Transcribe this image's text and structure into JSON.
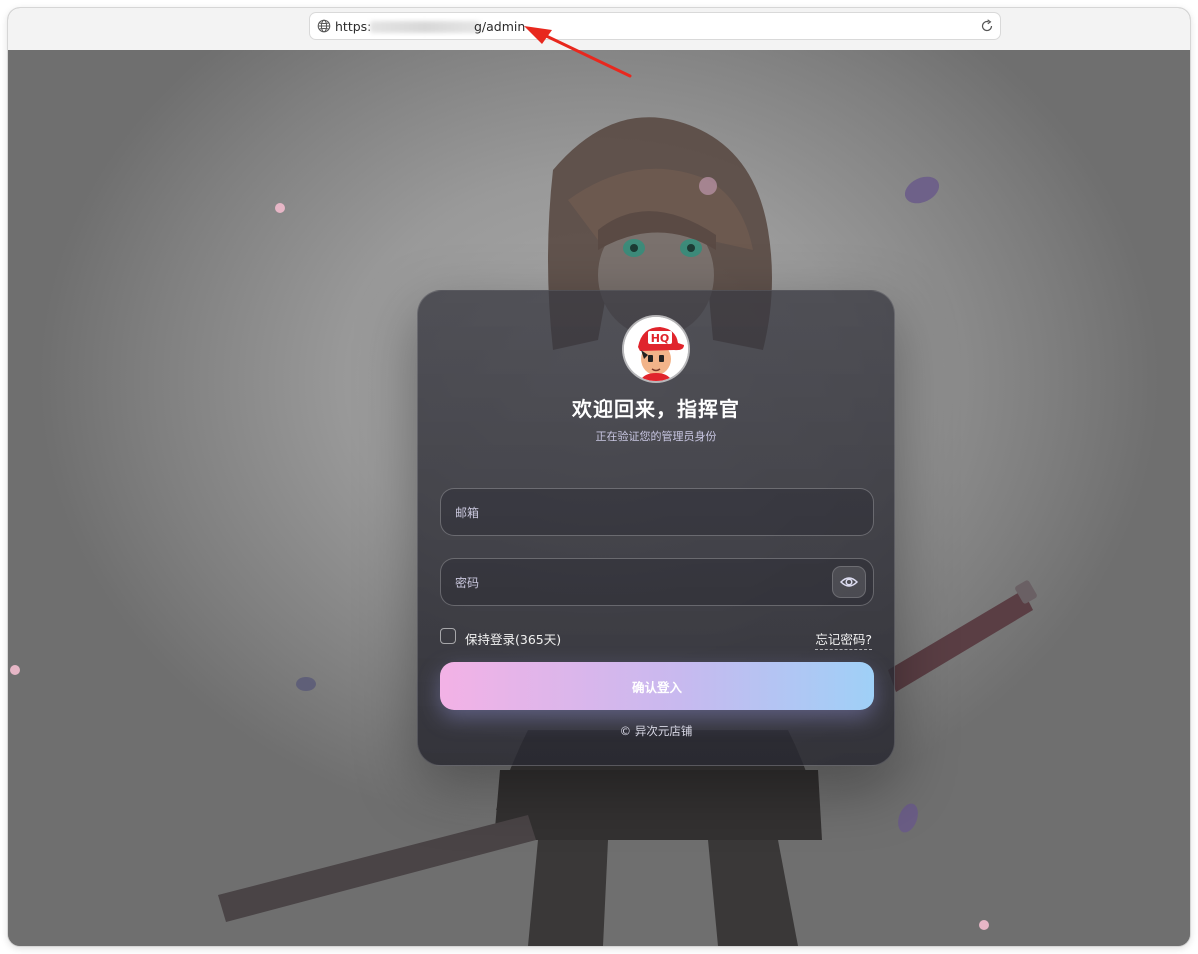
{
  "browser": {
    "url_prefix": "https:",
    "url_suffix": "g/admin",
    "icons": [
      "globe-icon",
      "reload-icon"
    ]
  },
  "login": {
    "title": "欢迎回来，指挥官",
    "subtitle": "正在验证您的管理员身份",
    "email_placeholder": "邮箱",
    "password_placeholder": "密码",
    "remember_label": "保持登录(365天)",
    "remember_checked": false,
    "forgot_label": "忘记密码?",
    "submit_label": "确认登入",
    "footer": "© 异次元店铺",
    "avatar_badge": "HQ",
    "icons": [
      "avatar-icon",
      "eye-icon"
    ]
  },
  "colors": {
    "accent_pink": "#f3b2e6",
    "accent_blue": "#9fd0f7",
    "annotation_arrow": "#e8281e"
  }
}
